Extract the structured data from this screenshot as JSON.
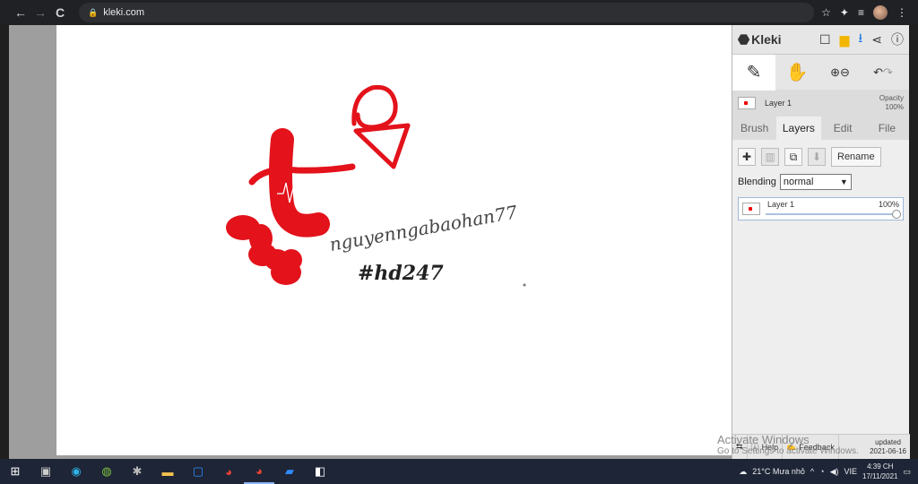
{
  "browser": {
    "url": "kleki.com",
    "nav": {
      "back": "←",
      "forward": "→",
      "reload": "C"
    },
    "icons": {
      "star": "☆",
      "puzzle": "✦",
      "menu": "⋮",
      "queue": "≡"
    }
  },
  "kleki": {
    "brand": "Kleki",
    "layer_name": "Layer 1",
    "opacity_label": "Opacity",
    "opacity_value": "100%",
    "tabs": [
      "Brush",
      "Layers",
      "Edit",
      "File"
    ],
    "active_tab": "Layers",
    "rename_label": "Rename",
    "blending_label": "Blending",
    "blending_value": "normal",
    "layer_item": {
      "name": "Layer 1",
      "opacity": "100%"
    },
    "footer": {
      "help": "Help",
      "feedback": "Feedback",
      "updated_label": "updated",
      "updated_date": "2021-06-16"
    }
  },
  "canvas_text": {
    "line1": "nguyenngabaohan77",
    "line2": "#hd247"
  },
  "watermark": {
    "title": "Activate Windows",
    "subtitle": "Go to Settings to activate Windows."
  },
  "taskbar": {
    "weather": "21°C  Mưa nhỏ",
    "lang": "VIE",
    "time": "4:39 CH",
    "date": "17/11/2021"
  },
  "colors": {
    "ink": "#e3121b",
    "panel": "#dcdcdc",
    "accent_blue": "#1a73e8"
  }
}
